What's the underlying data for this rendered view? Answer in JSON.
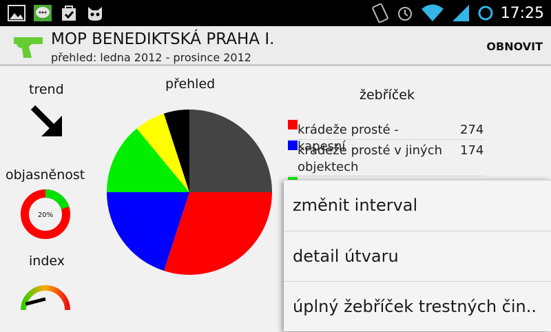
{
  "status_bar": {
    "time": "17:25",
    "notification_icons": [
      "image-icon",
      "chat-bubble-icon",
      "checked-bag-icon",
      "cat-icon"
    ],
    "system_icons": [
      "rotation-lock-icon",
      "alarm-icon",
      "wifi-icon",
      "signal-icon",
      "sync-icon"
    ]
  },
  "action_bar": {
    "title": "MOP BENEDIKTSKÁ PRAHA I.",
    "subtitle": "přehled: ledna 2012 - prosince 2012",
    "refresh_label": "OBNOVIT",
    "app_icon": "pistol-icon"
  },
  "trend": {
    "label": "trend",
    "icon": "arrow-down-right-icon"
  },
  "clearance": {
    "label": "objasněnost",
    "value_text": "20%",
    "fraction": 0.2,
    "colors": {
      "done": "#00e000",
      "rest": "#ff0000"
    }
  },
  "index": {
    "label": "index",
    "gauge_level": 0.1
  },
  "overview": {
    "label": "přehled"
  },
  "chart_data": {
    "type": "pie",
    "title": "přehled",
    "series": [
      {
        "color": "#444444",
        "value": 25
      },
      {
        "color": "#ff0000",
        "value": 30
      },
      {
        "color": "#0000ff",
        "value": 20
      },
      {
        "color": "#00ee00",
        "value": 14
      },
      {
        "color": "#ffff00",
        "value": 6
      },
      {
        "color": "#000000",
        "value": 5
      }
    ]
  },
  "ladder": {
    "label": "žebříček",
    "items": [
      {
        "name": "krádeže prosté - kapesní",
        "count": "274",
        "color": "#ff0000"
      },
      {
        "name": "krádeže prosté v jiných objektech",
        "count": "174",
        "color": "#0000ff"
      },
      {
        "name": "",
        "count": "",
        "color": "#00ee00"
      }
    ]
  },
  "menu": {
    "items": [
      {
        "label": "změnit interval"
      },
      {
        "label": "detail útvaru"
      },
      {
        "label": "úplný žebříček trestných čin.."
      }
    ]
  }
}
